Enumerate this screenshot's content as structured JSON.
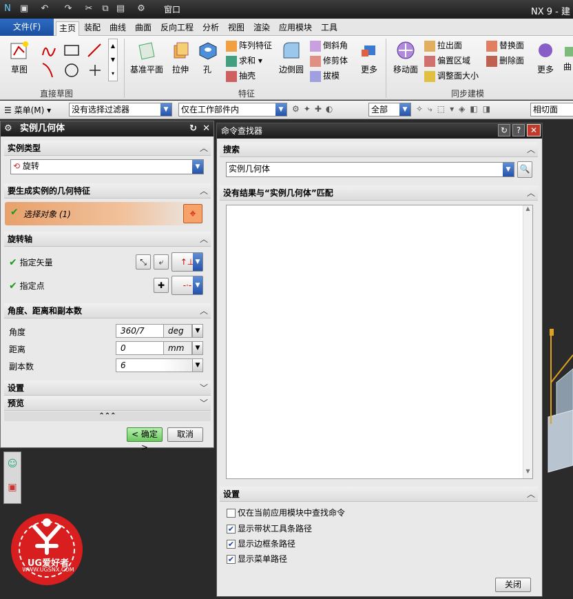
{
  "titlebar": {
    "app_title": "NX 9 - 建",
    "window_menu": "窗口"
  },
  "tabs": {
    "file": "文件(F)",
    "items": [
      "主页",
      "装配",
      "曲线",
      "曲面",
      "反向工程",
      "分析",
      "视图",
      "渲染",
      "应用模块",
      "工具"
    ]
  },
  "ribbon": {
    "sketch": {
      "label": "草图",
      "group": "直接草图"
    },
    "feature": {
      "datum_plane": "基准平面",
      "extrude": "拉伸",
      "hole": "孔",
      "pattern": "阵列特征",
      "unite": "求和",
      "shell": "抽壳",
      "edge_blend": "边倒圆",
      "chamfer": "倒斜角",
      "trim_body": "修剪体",
      "draft": "拔模",
      "more": "更多",
      "group": "特征"
    },
    "sync": {
      "move_face": "移动面",
      "pull_face": "拉出面",
      "offset_region": "偏置区域",
      "resize_face": "调整面大小",
      "replace_face": "替换面",
      "delete_face": "删除面",
      "more": "更多",
      "group": "同步建模",
      "extra": "曲"
    }
  },
  "filterbar": {
    "menu": "菜单(M)",
    "filter": "没有选择过滤器",
    "scope": "仅在工作部件内",
    "all": "全部",
    "section": "相切面"
  },
  "dialog": {
    "title": "实例几何体",
    "instance_type_section": "实例类型",
    "instance_type_value": "旋转",
    "geometry_section": "要生成实例的几何特征",
    "select_object": "选择对象 (1)",
    "axis_section": "旋转轴",
    "specify_vector": "指定矢量",
    "specify_point": "指定点",
    "adc_section": "角度、距离和副本数",
    "angle_label": "角度",
    "angle_value": "360/7",
    "angle_unit": "deg",
    "distance_label": "距离",
    "distance_value": "0",
    "distance_unit": "mm",
    "copies_label": "副本数",
    "copies_value": "6",
    "settings_section": "设置",
    "preview_section": "预览",
    "ok": "< 确定 >",
    "cancel": "取消"
  },
  "finder": {
    "title": "命令查找器",
    "search_section": "搜索",
    "search_value": "实例几何体",
    "result_header": "没有结果与“实例几何体”匹配",
    "settings_section": "设置",
    "options": [
      {
        "label": "仅在当前应用模块中查找命令",
        "checked": false
      },
      {
        "label": "显示带状工具条路径",
        "checked": true
      },
      {
        "label": "显示边框条路径",
        "checked": true
      },
      {
        "label": "显示菜单路径",
        "checked": true
      }
    ],
    "close": "关闭"
  },
  "logo": {
    "text": "UG爱好者",
    "url_text": "WWW.UGSNX.COM"
  },
  "colors": {
    "file_tab": "#1b4f9e",
    "select_highlight": "#e7a16c",
    "checkbox": "#1a3fa8"
  }
}
